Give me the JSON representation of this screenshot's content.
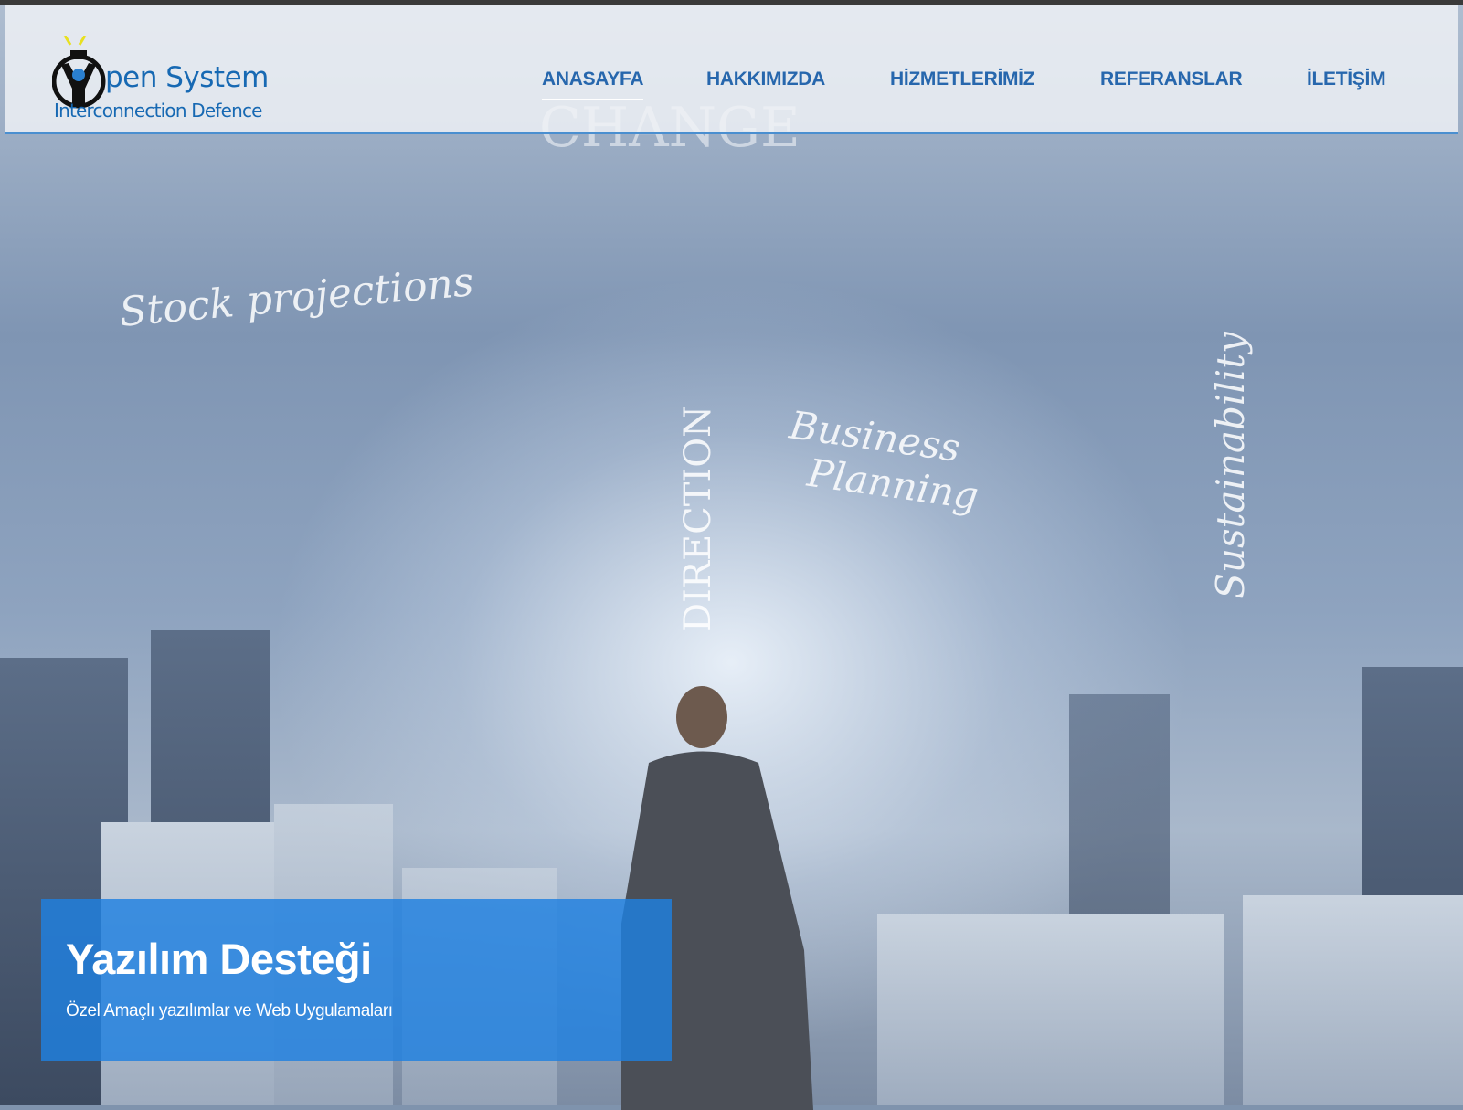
{
  "logo": {
    "title": "pen System",
    "subtitle": "Interconnection Defence"
  },
  "nav": {
    "items": [
      {
        "label": "ANASAYFA",
        "active": true
      },
      {
        "label": "HAKKIMIZDA"
      },
      {
        "label": "HİZMETLERİMİZ"
      },
      {
        "label": "REFERANSLAR"
      },
      {
        "label": "İLETİŞİM"
      }
    ]
  },
  "slide": {
    "title": "Yazılım Desteği",
    "subtitle": "Özel Amaçlı yazılımlar ve Web Uygulamaları"
  },
  "colors": {
    "brand": "#1769b3",
    "nav": "#2767ad",
    "caption_bg": "#1e80e1"
  }
}
